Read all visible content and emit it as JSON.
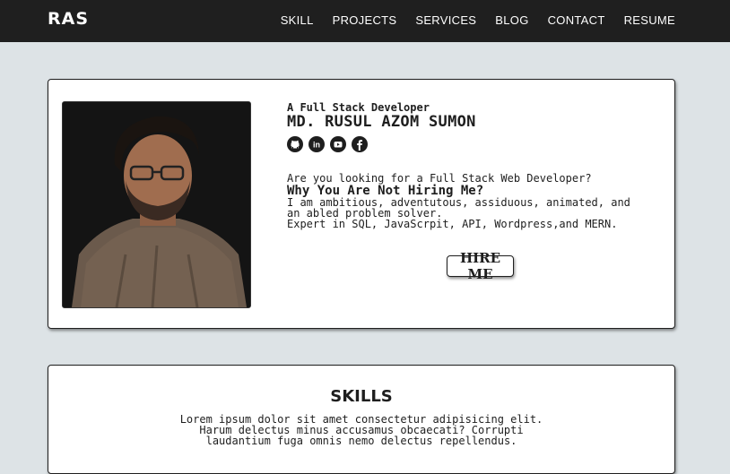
{
  "nav": {
    "logo": "RAS",
    "links": [
      "SKILL",
      "PROJECTS",
      "SERVICES",
      "BLOG",
      "CONTACT",
      "RESUME"
    ]
  },
  "hero": {
    "subtitle": "A Full Stack Developer",
    "name": "MD. RUSUL AZOM SUMON",
    "socials": [
      "github-icon",
      "linkedin-icon",
      "youtube-icon",
      "facebook-icon"
    ],
    "question": "Are you looking for a Full Stack Web Developer?",
    "why": "Why You Are Not Hiring Me?",
    "description": "I am ambitious, adventutous, assiduous, animated, and\nan abled problem solver.\nExpert in SQL, JavaScrpit, API, Wordpress,and MERN.",
    "hire_label": "HIRE ME"
  },
  "skills": {
    "title": "SKILLS",
    "text": "Lorem ipsum dolor sit amet consectetur adipisicing elit. Harum delectus minus accusamus obcaecati? Corrupti laudantium fuga omnis nemo delectus repellendus."
  },
  "colors": {
    "navbar": "#1f1f1f",
    "page_background": "#dde3e6",
    "card_background": "#ffffff",
    "text": "#1e1e1e"
  }
}
